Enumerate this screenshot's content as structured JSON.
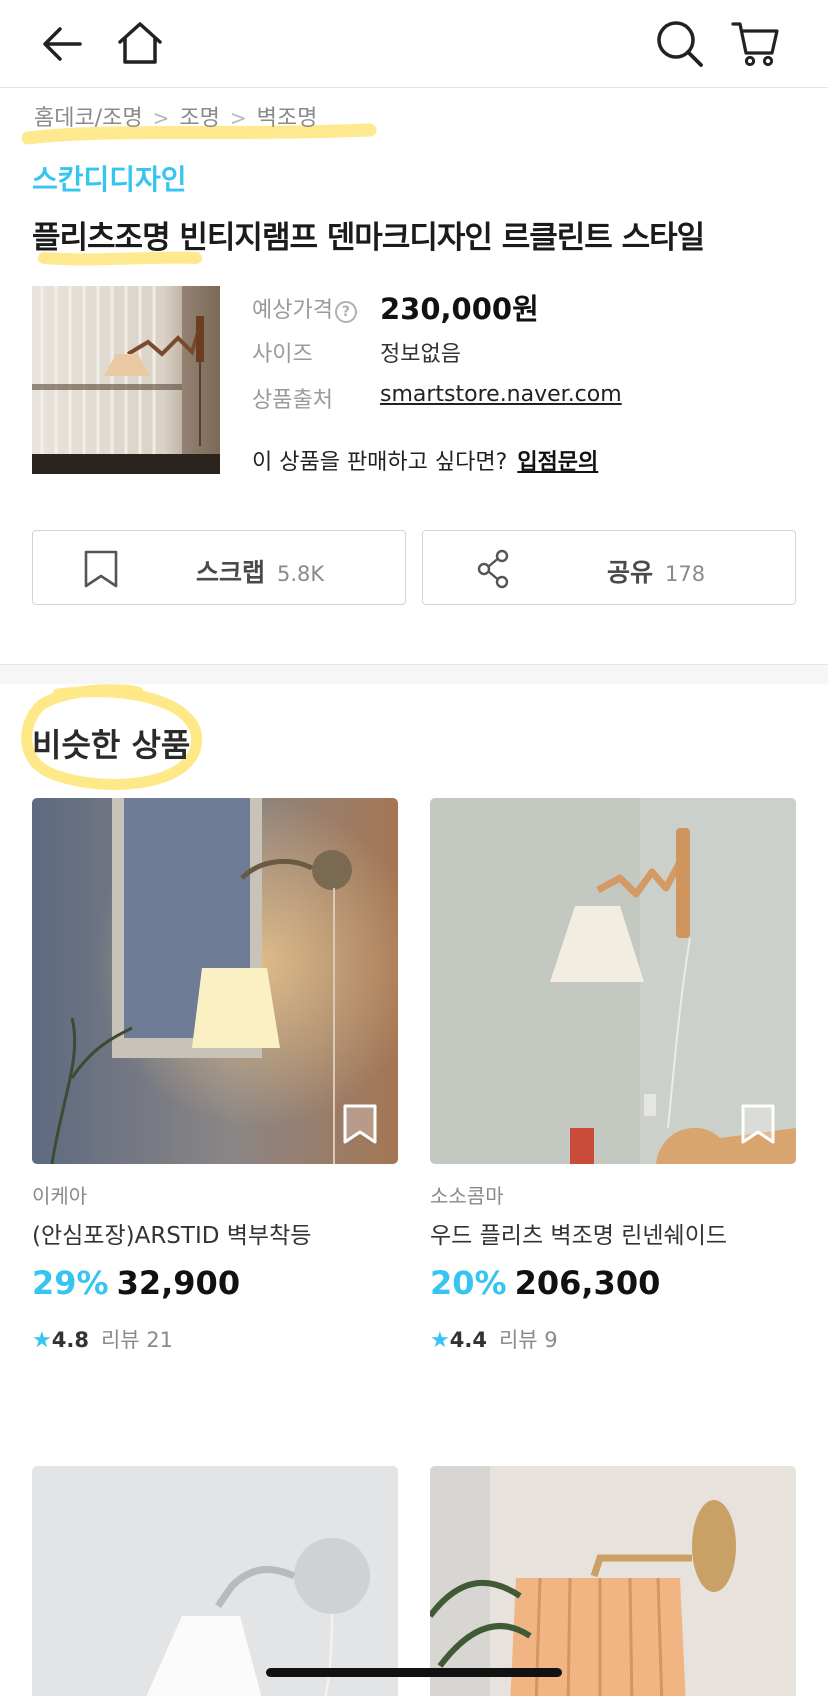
{
  "breadcrumb": [
    "홈데코/조명",
    "조명",
    "벽조명"
  ],
  "product": {
    "brand": "스칸디디자인",
    "title": "플리츠조명 빈티지램프 덴마크디자인 르클린트 스타일",
    "price_label": "예상가격",
    "price": "230,000원",
    "size_label": "사이즈",
    "size_value": "정보없음",
    "source_label": "상품출처",
    "source_value": "smartstore.naver.com",
    "sell_question": "이 상품을 판매하고 싶다면?",
    "sell_link": "입점문의"
  },
  "actions": {
    "scrap_label": "스크랩",
    "scrap_count": "5.8K",
    "share_label": "공유",
    "share_count": "178"
  },
  "similar": {
    "title": "비슷한 상품",
    "items": [
      {
        "store": "이케아",
        "name": "(안심포장)ARSTID 벽부착등",
        "discount": "29%",
        "price": "32,900",
        "rating": "4.8",
        "reviews": "리뷰 21"
      },
      {
        "store": "소소콤마",
        "name": "우드 플리츠 벽조명 린넨쉐이드",
        "discount": "20%",
        "price": "206,300",
        "rating": "4.4",
        "reviews": "리뷰 9"
      },
      {
        "store": "",
        "name": "",
        "discount": "",
        "price": "",
        "rating": "",
        "reviews": ""
      },
      {
        "store": "",
        "name": "",
        "discount": "",
        "price": "",
        "rating": "",
        "reviews": ""
      }
    ]
  },
  "colors": {
    "accent": "#35c5f0",
    "highlight": "#ffe57a"
  },
  "icons": [
    "back-arrow-icon",
    "home-icon",
    "search-icon",
    "cart-icon",
    "bookmark-icon",
    "share-icon",
    "help-icon",
    "star-icon"
  ]
}
